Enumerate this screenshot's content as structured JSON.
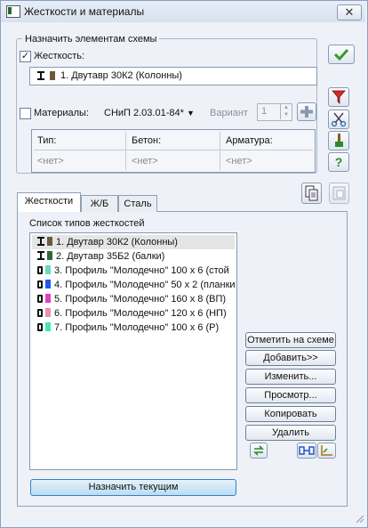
{
  "window": {
    "title": "Жесткости и материалы",
    "close": "✕"
  },
  "assign": {
    "group_title": "Назначить элементам схемы",
    "stiffness_label": "Жесткость:",
    "stiffness_checked": true,
    "stiffness_value": "1. Двутавр 30К2 (Колонны)",
    "materials_label": "Материалы:",
    "materials_checked": false,
    "norm_value": "СНиП 2.03.01-84*",
    "variant_label": "Вариант",
    "variant_value": "1",
    "columns": [
      {
        "header": "Тип:",
        "value": "<нет>"
      },
      {
        "header": "Бетон:",
        "value": "<нет>"
      },
      {
        "header": "Арматура:",
        "value": "<нет>"
      }
    ]
  },
  "tabs": [
    {
      "label": "Жесткости",
      "active": true
    },
    {
      "label": "Ж/Б",
      "active": false
    },
    {
      "label": "Сталь",
      "active": false
    }
  ],
  "list": {
    "title": "Список типов жесткостей",
    "items": [
      {
        "label": "1. Двутавр 30К2 (Колонны)",
        "icon": "i-beam-icon",
        "color": "#6b5a3a",
        "selected": true
      },
      {
        "label": "2. Двутавр 35Б2 (балки)",
        "icon": "i-beam-icon",
        "color": "#2e6b3a",
        "selected": false
      },
      {
        "label": "3. Профиль \"Молодечно\" 100 x 6 (стой",
        "icon": "box-profile-icon",
        "color": "#66ddc0",
        "selected": false
      },
      {
        "label": "4. Профиль \"Молодечно\" 50 x 2 (планки",
        "icon": "box-profile-icon",
        "color": "#2255ee",
        "selected": false
      },
      {
        "label": "5. Профиль \"Молодечно\" 160 x 8 (ВП)",
        "icon": "box-profile-icon",
        "color": "#e040c0",
        "selected": false
      },
      {
        "label": "6. Профиль \"Молодечно\" 120 x 6 (НП)",
        "icon": "box-profile-icon",
        "color": "#e890b0",
        "selected": false
      },
      {
        "label": "7. Профиль \"Молодечно\" 100 x 6 (Р)",
        "icon": "box-profile-icon",
        "color": "#44e8b0",
        "selected": false
      }
    ]
  },
  "buttons": {
    "mark": "Отметить на схеме",
    "add": "Добавить>>",
    "edit": "Изменить...",
    "view": "Просмотр...",
    "copy": "Копировать",
    "delete": "Удалить",
    "assign_current": "Назначить текущим"
  }
}
